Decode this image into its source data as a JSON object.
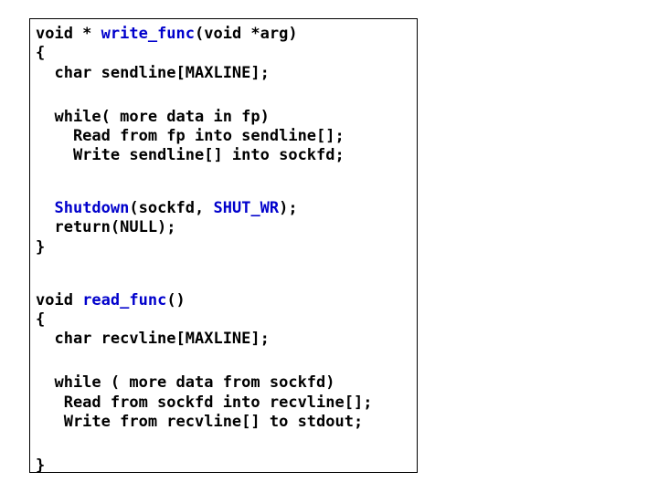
{
  "code": {
    "l1a": "void * ",
    "l1b": "write_func",
    "l1c": "(void *arg)",
    "l2": "{",
    "l3": "  char sendline[MAXLINE];",
    "l4": "  while( more data in fp)",
    "l5": "    Read from fp into sendline[];",
    "l6": "    Write sendline[] into sockfd;",
    "l7a": "  ",
    "l7b": "Shutdown",
    "l7c": "(sockfd, ",
    "l7d": "SHUT_WR",
    "l7e": ");",
    "l8": "  return(NULL);",
    "l9": "}",
    "l10a": "void ",
    "l10b": "read_func",
    "l10c": "()",
    "l11": "{",
    "l12": "  char recvline[MAXLINE];",
    "l13": "  while ( more data from sockfd)",
    "l14": "   Read from sockfd into recvline[];",
    "l15": "   Write from recvline[] to stdout;",
    "l16": "}"
  }
}
